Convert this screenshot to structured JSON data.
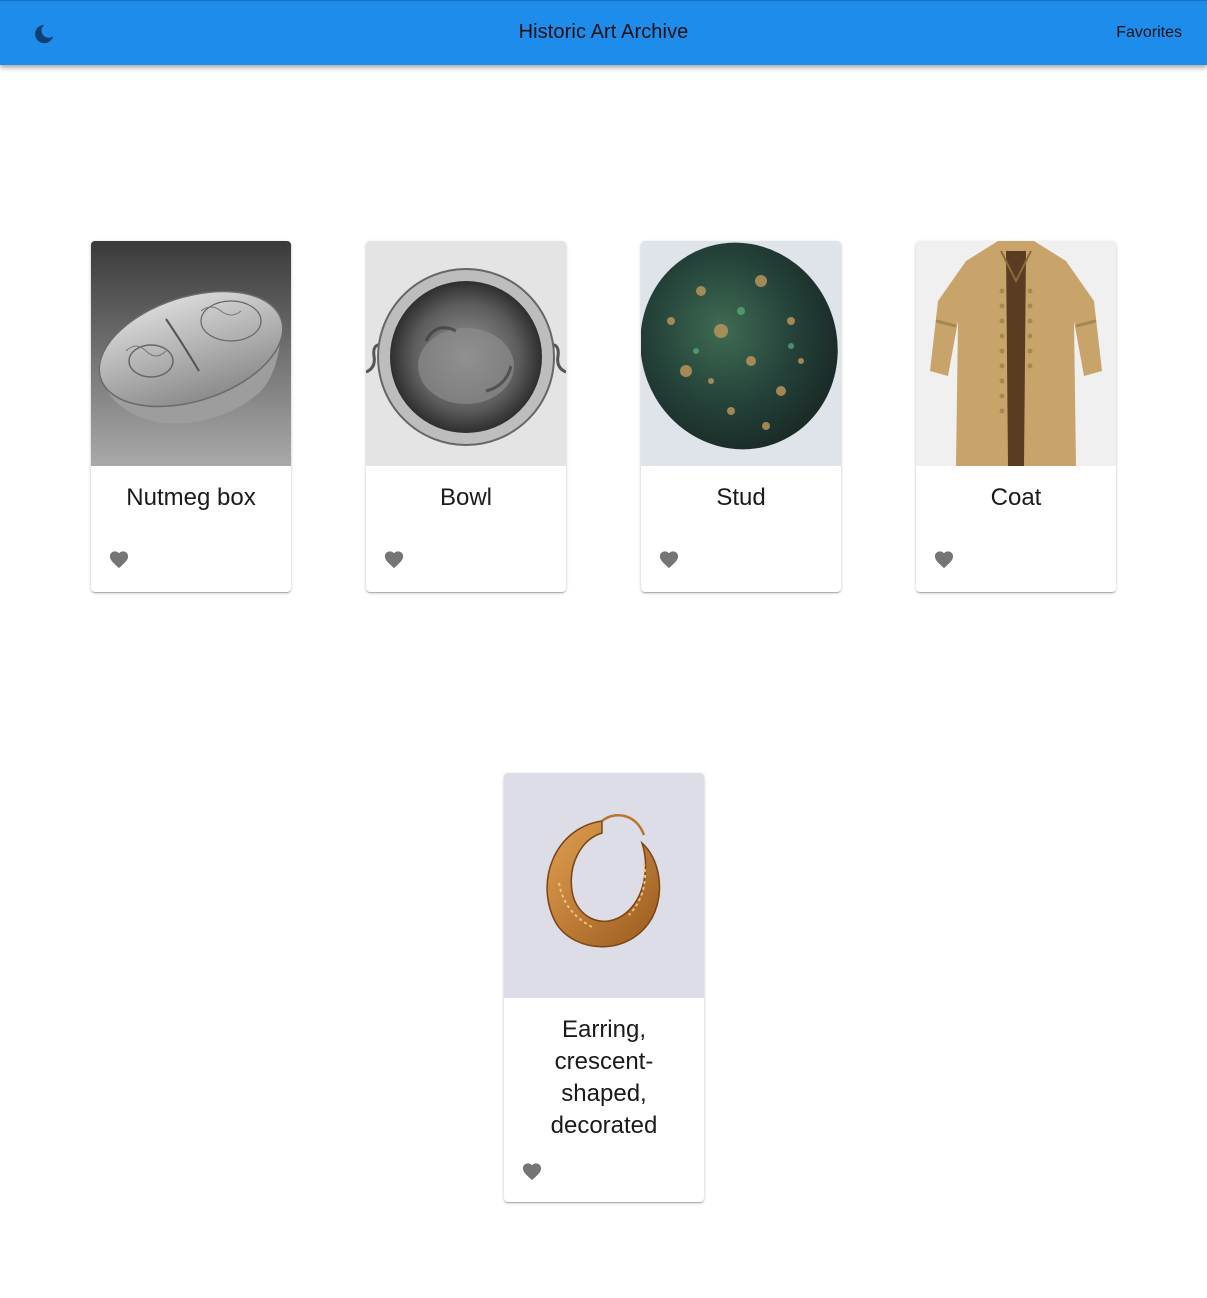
{
  "header": {
    "title": "Historic Art Archive",
    "favorites_label": "Favorites",
    "theme_icon": "moon-icon",
    "accent": "#1e8ceb"
  },
  "cards": [
    {
      "title": "Nutmeg box",
      "icon": "heart-icon"
    },
    {
      "title": "Bowl",
      "icon": "heart-icon"
    },
    {
      "title": "Stud",
      "icon": "heart-icon"
    },
    {
      "title": "Coat",
      "icon": "heart-icon"
    },
    {
      "title": "Earring, crescent-shaped, decorated",
      "icon": "heart-icon"
    }
  ]
}
